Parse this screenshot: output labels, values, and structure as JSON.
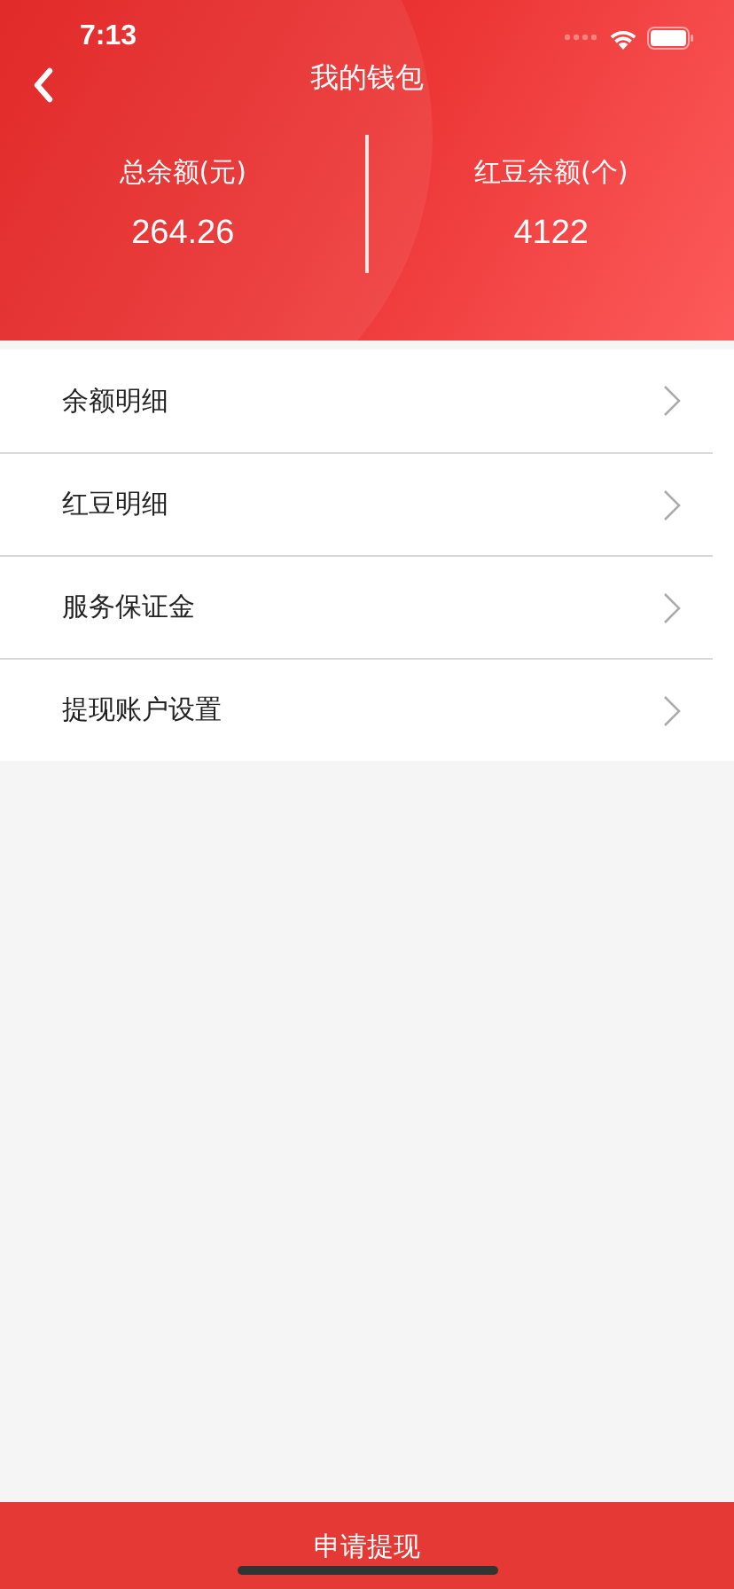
{
  "status_bar": {
    "time": "7:13"
  },
  "header": {
    "title": "我的钱包"
  },
  "balances": [
    {
      "label": "总余额(元)",
      "value": "264.26"
    },
    {
      "label": "红豆余额(个)",
      "value": "4122"
    }
  ],
  "menu": [
    {
      "label": "余额明细"
    },
    {
      "label": "红豆明细"
    },
    {
      "label": "服务保证金"
    },
    {
      "label": "提现账户设置"
    }
  ],
  "bottom_button": {
    "label": "申请提现"
  }
}
